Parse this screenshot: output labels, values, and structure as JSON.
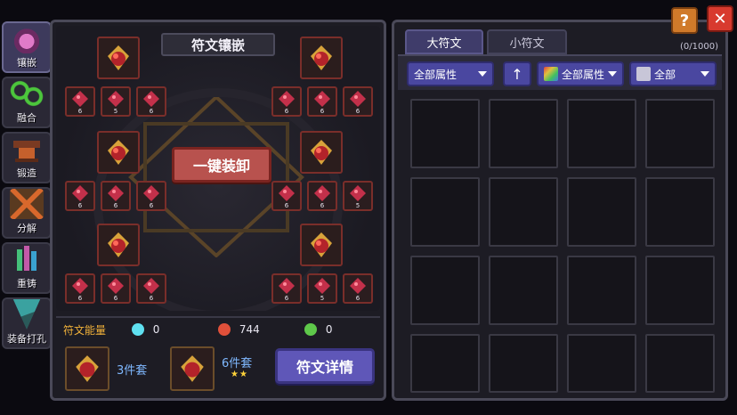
{
  "side_tabs": [
    {
      "label": "镶嵌",
      "icon": "flask-icon",
      "active": true,
      "color": "#c35aa8"
    },
    {
      "label": "融合",
      "icon": "rings-icon",
      "active": false,
      "color": "#4cc63c"
    },
    {
      "label": "锻造",
      "icon": "anvil-icon",
      "active": false,
      "color": "#c5602c"
    },
    {
      "label": "分解",
      "icon": "cross-swords-icon",
      "active": false,
      "color": "#d8682c"
    },
    {
      "label": "重铸",
      "icon": "crystal-icon",
      "active": false,
      "color": "#45c07a"
    },
    {
      "label": "装备打孔",
      "icon": "drill-icon",
      "active": false,
      "color": "#3aa2a0"
    }
  ],
  "inlay": {
    "title": "符文镶嵌",
    "unequip_all": "一键装卸",
    "small_rune_levels": {
      "row1_left": [
        "6",
        "5",
        "6"
      ],
      "row1_right": [
        "6",
        "6",
        "6"
      ],
      "row2_left": [
        "6",
        "6",
        "6"
      ],
      "row2_right": [
        "6",
        "6",
        "5"
      ],
      "row3_left": [
        "6",
        "6",
        "6"
      ],
      "row3_right": [
        "6",
        "5",
        "6"
      ]
    }
  },
  "energy": {
    "label": "符文能量",
    "cyan": "0",
    "red": "744",
    "green": "0"
  },
  "sets": {
    "set3_label": "3件套",
    "set6_label": "6件套",
    "set6_stars": "★★",
    "detail_button": "符文详情"
  },
  "tabs": {
    "big": "大符文",
    "small": "小符文",
    "count": "(0/1000)"
  },
  "filters": {
    "attr1": "全部属性",
    "sort_icon": "↑",
    "attr2": "全部属性",
    "type": "全部"
  },
  "top_buttons": {
    "help": "?",
    "close": "✕"
  },
  "colors": {
    "accent_red": "#b8524e",
    "accent_purple": "#5f57b8",
    "energy_label": "#f2b23a",
    "set_label": "#7fb8ff"
  }
}
